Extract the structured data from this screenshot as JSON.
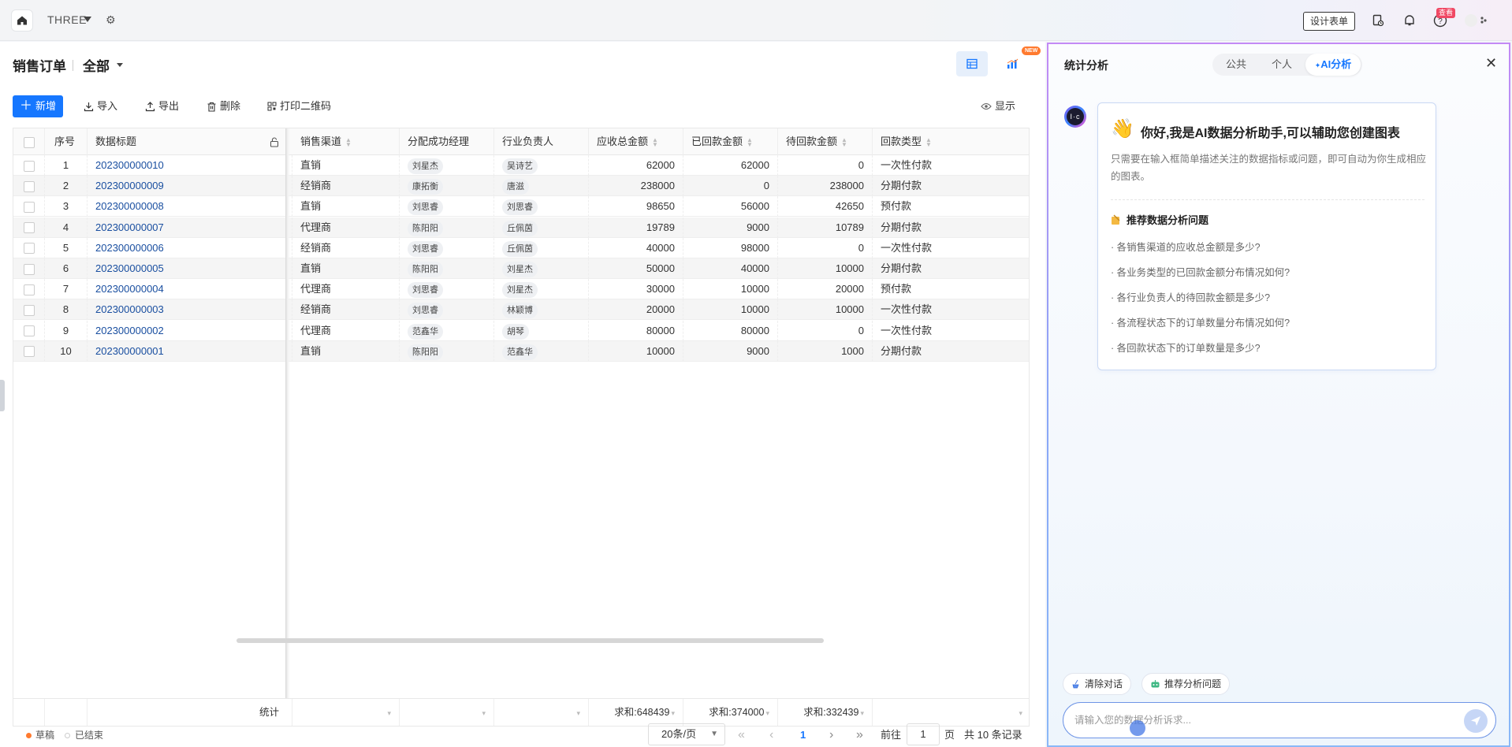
{
  "topbar": {
    "app_name": "THREE",
    "design_button": "设计表单",
    "hot_badge": "查看",
    "icons": [
      "home-icon",
      "settings-icon",
      "form-log-icon",
      "bell-icon",
      "help-icon",
      "avatar-icon"
    ]
  },
  "page": {
    "title": "销售订单",
    "view": "全部"
  },
  "toolbar": {
    "new": "新增",
    "import": "导入",
    "export": "导出",
    "delete": "删除",
    "print_qr": "打印二维码",
    "show": "显示",
    "new_badge": "NEW"
  },
  "table": {
    "headers": {
      "index": "序号",
      "title": "数据标题",
      "channel": "销售渠道",
      "manager": "分配成功经理",
      "owner": "行业负责人",
      "receivable": "应收总金额",
      "received": "已回款金额",
      "pending": "待回款金额",
      "payment_type": "回款类型"
    },
    "rows": [
      {
        "index": "1",
        "title": "202300000010",
        "channel": "直销",
        "manager": "刘星杰",
        "owner": "吴诗艺",
        "receivable": "62000",
        "received": "62000",
        "pending": "0",
        "payment_type": "一次性付款"
      },
      {
        "index": "2",
        "title": "202300000009",
        "channel": "经销商",
        "manager": "康拓衡",
        "owner": "唐滋",
        "receivable": "238000",
        "received": "0",
        "pending": "238000",
        "payment_type": "分期付款"
      },
      {
        "index": "3",
        "title": "202300000008",
        "channel": "直销",
        "manager": "刘思睿",
        "owner": "刘思睿",
        "receivable": "98650",
        "received": "56000",
        "pending": "42650",
        "payment_type": "预付款"
      },
      {
        "index": "4",
        "title": "202300000007",
        "channel": "代理商",
        "manager": "陈阳阳",
        "owner": "丘佩茵",
        "receivable": "19789",
        "received": "9000",
        "pending": "10789",
        "payment_type": "分期付款"
      },
      {
        "index": "5",
        "title": "202300000006",
        "channel": "经销商",
        "manager": "刘思睿",
        "owner": "丘佩茵",
        "receivable": "40000",
        "received": "98000",
        "pending": "0",
        "payment_type": "一次性付款"
      },
      {
        "index": "6",
        "title": "202300000005",
        "channel": "直销",
        "manager": "陈阳阳",
        "owner": "刘星杰",
        "receivable": "50000",
        "received": "40000",
        "pending": "10000",
        "payment_type": "分期付款"
      },
      {
        "index": "7",
        "title": "202300000004",
        "channel": "代理商",
        "manager": "刘思睿",
        "owner": "刘星杰",
        "receivable": "30000",
        "received": "10000",
        "pending": "20000",
        "payment_type": "预付款"
      },
      {
        "index": "8",
        "title": "202300000003",
        "channel": "经销商",
        "manager": "刘思睿",
        "owner": "林颖博",
        "receivable": "20000",
        "received": "10000",
        "pending": "10000",
        "payment_type": "一次性付款"
      },
      {
        "index": "9",
        "title": "202300000002",
        "channel": "代理商",
        "manager": "范鑫华",
        "owner": "胡琴",
        "receivable": "80000",
        "received": "80000",
        "pending": "0",
        "payment_type": "一次性付款"
      },
      {
        "index": "10",
        "title": "202300000001",
        "channel": "直销",
        "manager": "陈阳阳",
        "owner": "范鑫华",
        "receivable": "10000",
        "received": "9000",
        "pending": "1000",
        "payment_type": "分期付款"
      }
    ],
    "footer": {
      "label": "统计",
      "receivable_sum": "求和:648439",
      "received_sum": "求和:374000",
      "pending_sum": "求和:332439"
    }
  },
  "status": {
    "draft": "草稿",
    "finished": "已结束",
    "draft_color": "#ff7a2f",
    "finished_color": "#d0d0d0"
  },
  "pager": {
    "page_size": "20条/页",
    "current_page": "1",
    "goto_label": "前往",
    "goto_value": "1",
    "page_unit": "页",
    "total": "共 10 条记录"
  },
  "ai_panel": {
    "title": "统计分析",
    "tabs": [
      "公共",
      "个人",
      "AI分析"
    ],
    "active_tab": "AI分析",
    "avatar_text": "I·c",
    "greeting": "你好,我是AI数据分析助手,可以辅助您创建图表",
    "description": "只需要在输入框简单描述关注的数据指标或问题，即可自动为你生成相应的图表。",
    "recommend_title": "推荐数据分析问题",
    "questions": [
      "· 各销售渠道的应收总金额是多少?",
      "· 各业务类型的已回款金额分布情况如何?",
      "· 各行业负责人的待回款金额是多少?",
      "· 各流程状态下的订单数量分布情况如何?",
      "· 各回款状态下的订单数量是多少?"
    ],
    "clear_button": "清除对话",
    "recommend_button": "推荐分析问题",
    "input_placeholder": "请输入您的数据分析诉求..."
  },
  "colors": {
    "primary": "#1677ff",
    "link": "#1a4fa0"
  }
}
